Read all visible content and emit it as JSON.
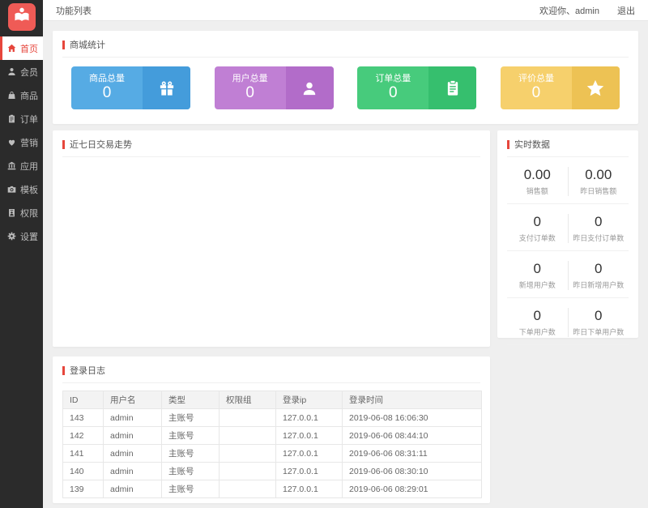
{
  "topbar": {
    "title": "功能列表",
    "welcome": "欢迎你、admin",
    "logout": "退出"
  },
  "sidebar": {
    "items": [
      {
        "label": "首页",
        "icon": "home-icon",
        "active": true
      },
      {
        "label": "会员",
        "icon": "user-icon",
        "active": false
      },
      {
        "label": "商品",
        "icon": "shopping-bag-icon",
        "active": false
      },
      {
        "label": "订单",
        "icon": "order-clipboard-icon",
        "active": false
      },
      {
        "label": "营销",
        "icon": "heart-icon",
        "active": false
      },
      {
        "label": "应用",
        "icon": "bank-icon",
        "active": false
      },
      {
        "label": "模板",
        "icon": "camera-icon",
        "active": false
      },
      {
        "label": "权限",
        "icon": "id-badge-icon",
        "active": false
      },
      {
        "label": "设置",
        "icon": "gear-icon",
        "active": false
      }
    ]
  },
  "stats_panel": {
    "title": "商城统计",
    "cards": [
      {
        "label": "商品总量",
        "value": "0",
        "icon": "gift-icon",
        "color": "#56abe4",
        "color_dark": "#449cdb"
      },
      {
        "label": "用户总量",
        "value": "0",
        "icon": "user-icon",
        "color": "#c07fd4",
        "color_dark": "#b26cc9"
      },
      {
        "label": "订单总量",
        "value": "0",
        "icon": "clipboard-icon",
        "color": "#47cb7c",
        "color_dark": "#36bf6e"
      },
      {
        "label": "评价总量",
        "value": "0",
        "icon": "star-icon",
        "color": "#f6d06c",
        "color_dark": "#edc254"
      }
    ]
  },
  "trend_panel": {
    "title": "近七日交易走势"
  },
  "realtime_panel": {
    "title": "实时数据",
    "rows": [
      [
        {
          "value": "0.00",
          "label": "销售额"
        },
        {
          "value": "0.00",
          "label": "昨日销售额"
        }
      ],
      [
        {
          "value": "0",
          "label": "支付订单数"
        },
        {
          "value": "0",
          "label": "昨日支付订单数"
        }
      ],
      [
        {
          "value": "0",
          "label": "新增用户数"
        },
        {
          "value": "0",
          "label": "昨日新增用户数"
        }
      ],
      [
        {
          "value": "0",
          "label": "下单用户数"
        },
        {
          "value": "0",
          "label": "昨日下单用户数"
        }
      ]
    ]
  },
  "login_log": {
    "title": "登录日志",
    "headers": [
      "ID",
      "用户名",
      "类型",
      "权限组",
      "登录ip",
      "登录时间"
    ],
    "rows": [
      [
        "143",
        "admin",
        "主账号",
        "",
        "127.0.0.1",
        "2019-06-08 16:06:30"
      ],
      [
        "142",
        "admin",
        "主账号",
        "",
        "127.0.0.1",
        "2019-06-06 08:44:10"
      ],
      [
        "141",
        "admin",
        "主账号",
        "",
        "127.0.0.1",
        "2019-06-06 08:31:11"
      ],
      [
        "140",
        "admin",
        "主账号",
        "",
        "127.0.0.1",
        "2019-06-06 08:30:10"
      ],
      [
        "139",
        "admin",
        "主账号",
        "",
        "127.0.0.1",
        "2019-06-06 08:29:01"
      ]
    ]
  },
  "colors": {
    "accent_red": "#e6463c",
    "logo_red": "#ef5b56",
    "sidebar_bg": "#2b2b2b",
    "page_bg": "#efefef"
  }
}
